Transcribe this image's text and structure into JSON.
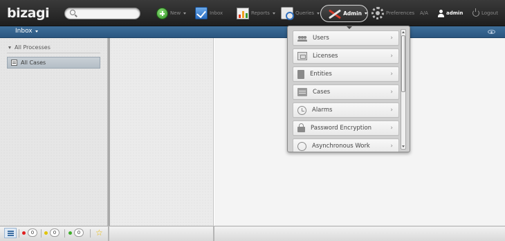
{
  "app": {
    "logo": "bizagi"
  },
  "search": {
    "value": "",
    "placeholder": ""
  },
  "nav": {
    "new_label": "New",
    "inbox_label": "Inbox",
    "reports_label": "Reports",
    "queries_label": "Queries",
    "admin_label": "Admin",
    "preferences_label": "Preferences",
    "font_size_label": "A/A",
    "user_label": "admin",
    "logout_label": "Logout"
  },
  "subbar": {
    "inbox_menu_label": "Inbox"
  },
  "tree": {
    "header_label": "All Processes",
    "selected_item_label": "All Cases"
  },
  "bottom": {
    "counters": [
      {
        "name": "red",
        "color": "#e02020",
        "value": "0"
      },
      {
        "name": "yellow",
        "color": "#e0c400",
        "value": "0"
      },
      {
        "name": "green",
        "color": "#3fae2a",
        "value": "0"
      }
    ]
  },
  "admin_menu": {
    "items": [
      {
        "label": "Users",
        "icon": "users-icon"
      },
      {
        "label": "Licenses",
        "icon": "licenses-icon"
      },
      {
        "label": "Entities",
        "icon": "entities-icon"
      },
      {
        "label": "Cases",
        "icon": "cases-icon"
      },
      {
        "label": "Alarms",
        "icon": "alarms-icon"
      },
      {
        "label": "Password Encryption",
        "icon": "lock-icon"
      },
      {
        "label": "Asynchronous Work",
        "icon": "async-icon"
      }
    ]
  },
  "colors": {
    "topbar": "#2a2a2a",
    "subbar": "#3a6890",
    "accent_green": "#3fae2a",
    "accent_blue": "#2a6cbf"
  }
}
